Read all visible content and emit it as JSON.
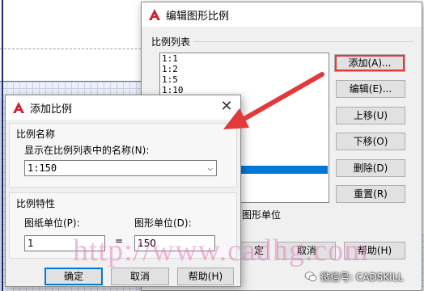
{
  "edit_dialog": {
    "title": "编辑图形比例",
    "list_label": "比例列表",
    "list_items": [
      "1:1",
      "1:2",
      "1:5",
      "1:10"
    ],
    "buttons": {
      "add": "添加(A)...",
      "edit": "编辑(E)...",
      "move_up": "上移(U)",
      "move_down": "下移(O)",
      "delete": "删除(D)",
      "reset": "重置(R)"
    },
    "drawing_units_partial": "图形单位",
    "ok_partial": "定",
    "cancel": "取消",
    "help": "帮助(H)"
  },
  "add_dialog": {
    "title": "添加比例",
    "close_glyph": "✕",
    "name_group_label": "比例名称",
    "name_field_label": "显示在比例列表中的名称(N):",
    "name_value": "1:150",
    "combo_glyph": "⌵",
    "props_group_label": "比例特性",
    "paper_units_label": "图纸单位(P):",
    "drawing_units_label": "图形单位(D):",
    "paper_units_value": "1",
    "drawing_units_value": "150",
    "equals": "=",
    "ok": "确定",
    "cancel": "取消",
    "help": "帮助(H)"
  },
  "watermark": {
    "text": "http://www.cadhg.com",
    "wechat_label": "微信号: CADSKILL"
  },
  "colors": {
    "app_logo_red": "#d0202e",
    "annotation_red": "#e23a3a",
    "selection_blue": "#0078d7"
  }
}
